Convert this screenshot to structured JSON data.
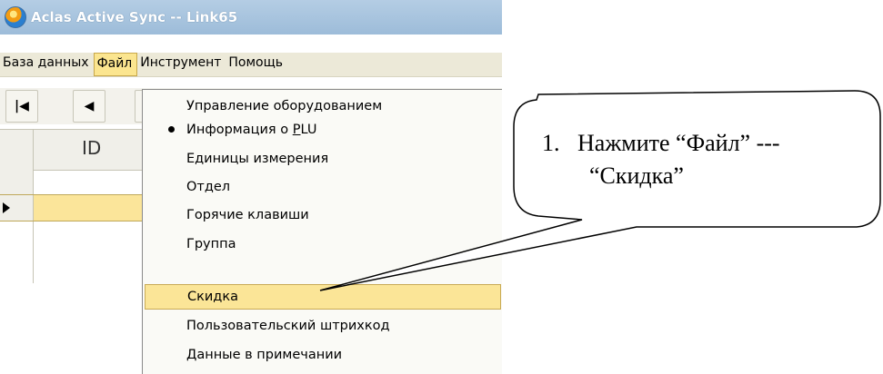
{
  "window": {
    "title": "Aclas Active Sync -- Link65"
  },
  "menubar": {
    "items": [
      {
        "label": "База данных",
        "active": false
      },
      {
        "label": "Файл",
        "active": true
      },
      {
        "label": "Инструмент",
        "active": false
      },
      {
        "label": "Помощь",
        "active": false
      }
    ]
  },
  "toolbar": {
    "first_glyph": "◀",
    "prev_glyph": "◀"
  },
  "grid": {
    "column_header": "ID"
  },
  "file_menu": {
    "items": [
      {
        "label": "Управление оборудованием",
        "checked": false,
        "highlighted": false
      },
      {
        "label_prefix": "Информация о ",
        "label_mnemonic": "P",
        "label_suffix": "LU",
        "checked": true,
        "highlighted": false
      },
      {
        "label": "Единицы измерения",
        "checked": false,
        "highlighted": false
      },
      {
        "label": "Отдел",
        "checked": false,
        "highlighted": false
      },
      {
        "label": "Горячие клавиши",
        "checked": false,
        "highlighted": false
      },
      {
        "label": "Группа",
        "checked": false,
        "highlighted": false
      },
      {
        "label": "Скидка",
        "checked": false,
        "highlighted": true
      },
      {
        "label": "Пользовательский штрихкод",
        "checked": false,
        "highlighted": false
      },
      {
        "label": "Данные в примечании",
        "checked": false,
        "highlighted": false
      }
    ]
  },
  "callout": {
    "number": "1.",
    "line1": "Нажмите “Файл” ---",
    "line2": "“Скидка”"
  },
  "colors": {
    "titlebar": "#9dbcd9",
    "menu_highlight": "#fbe597",
    "selected_row": "#fbe59a"
  }
}
